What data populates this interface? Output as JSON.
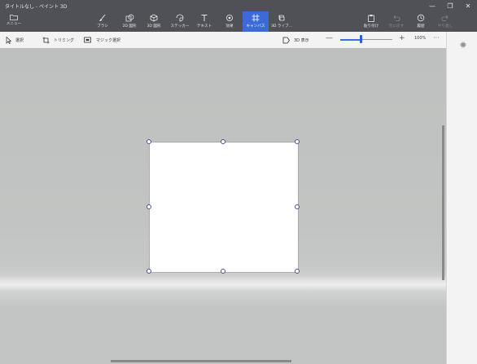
{
  "window": {
    "title": "タイトルなし - ペイント 3D",
    "minimize_glyph": "—",
    "maximize_glyph": "❐",
    "close_glyph": "✕"
  },
  "ribbon": {
    "menu_label": "メニュー",
    "items": [
      {
        "label": "ブラシ",
        "icon": "brush-icon"
      },
      {
        "label": "2D 図形",
        "icon": "2d-shapes-icon"
      },
      {
        "label": "3D 図形",
        "icon": "3d-shapes-icon"
      },
      {
        "label": "ステッカー",
        "icon": "stickers-icon"
      },
      {
        "label": "テキスト",
        "icon": "text-icon"
      },
      {
        "label": "効果",
        "icon": "effects-icon"
      },
      {
        "label": "キャンバス",
        "icon": "canvas-icon",
        "active": true
      },
      {
        "label": "3D ライブ...",
        "icon": "3d-library-icon"
      }
    ],
    "right_items": [
      {
        "label": "貼り付け",
        "icon": "paste-icon"
      },
      {
        "label": "元に戻す",
        "icon": "undo-icon",
        "disabled": true
      },
      {
        "label": "履歴",
        "icon": "history-icon"
      },
      {
        "label": "やり直し",
        "icon": "redo-icon",
        "disabled": true
      }
    ],
    "active_color": "#3c6bd8"
  },
  "toolbar": {
    "select_label": "選択",
    "crop_label": "トリミング",
    "magic_select_label": "マジック選択",
    "view3d_label": "3D 表示",
    "zoom_out_glyph": "—",
    "zoom_in_glyph": "+",
    "zoom_level": 100,
    "zoom_percent": "100%",
    "more_glyph": "···"
  },
  "panel": {
    "toggle_icon": "panel-toggle-icon"
  }
}
